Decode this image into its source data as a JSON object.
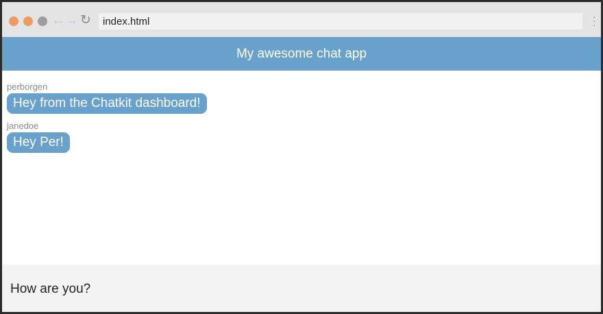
{
  "browser": {
    "address": "index.html",
    "icons": [
      "close-dot",
      "minimize-dot",
      "maximize-dot",
      "back-arrow-icon",
      "forward-arrow-icon",
      "reload-icon",
      "menu-icon"
    ]
  },
  "header": {
    "title": "My awesome chat app"
  },
  "messages": [
    {
      "user": "perborgen",
      "text": "Hey from the Chatkit dashboard!"
    },
    {
      "user": "janedoe",
      "text": "Hey Per!"
    }
  ],
  "composer": {
    "value": "How are you?"
  },
  "colors": {
    "accent": "#68a1cb"
  }
}
